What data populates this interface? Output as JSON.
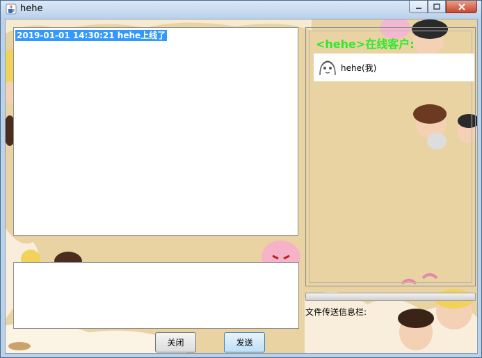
{
  "window": {
    "title": "hehe",
    "icons": {
      "app": "java-cup-icon",
      "minimize": "minimize-icon",
      "maximize": "maximize-icon",
      "close": "close-icon"
    }
  },
  "chat": {
    "messages": [
      {
        "text": "2019-01-01 14:30:21  hehe上线了"
      }
    ]
  },
  "input": {
    "value": ""
  },
  "buttons": {
    "close_label": "关闭",
    "send_label": "发送"
  },
  "online_panel": {
    "title": "<hehe>在线客户:",
    "users": [
      {
        "name": "hehe(我)",
        "avatar_icon": "cartoon-avatar-icon"
      }
    ]
  },
  "file_transfer": {
    "progress": 0,
    "label": "文件传送信息栏:"
  },
  "colors": {
    "highlight": "#3399ff",
    "online_title": "#2ee82e",
    "background": "#e9d3a2"
  }
}
